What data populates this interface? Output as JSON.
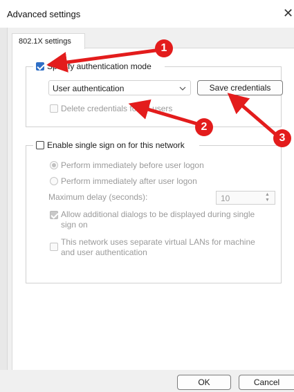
{
  "window": {
    "title": "Advanced settings",
    "close_glyph": "✕"
  },
  "tab": {
    "label": "802.1X settings"
  },
  "auth": {
    "specify_label": "Specify authentication mode",
    "specify_checked": true,
    "mode_value": "User authentication",
    "save_credentials": "Save credentials",
    "delete_credentials_label": "Delete credentials for all users"
  },
  "sso": {
    "enable_label": "Enable single sign on for this network",
    "before_logon": "Perform immediately before user logon",
    "after_logon": "Perform immediately after user logon",
    "max_delay_label": "Maximum delay (seconds):",
    "max_delay_value": "10",
    "allow_dialogs_label_1": "Allow additional dialogs to be displayed during single",
    "allow_dialogs_label_2": "sign on",
    "vlan_label_1": "This network uses separate virtual LANs for machine",
    "vlan_label_2": "and user authentication"
  },
  "buttons": {
    "ok": "OK",
    "cancel": "Cancel"
  },
  "annotations": {
    "badge1": "1",
    "badge2": "2",
    "badge3": "3",
    "color": "#e31c1c"
  },
  "icons": {
    "chevron": "chevron-down-icon",
    "spin_up": "▲",
    "spin_down": "▼"
  }
}
